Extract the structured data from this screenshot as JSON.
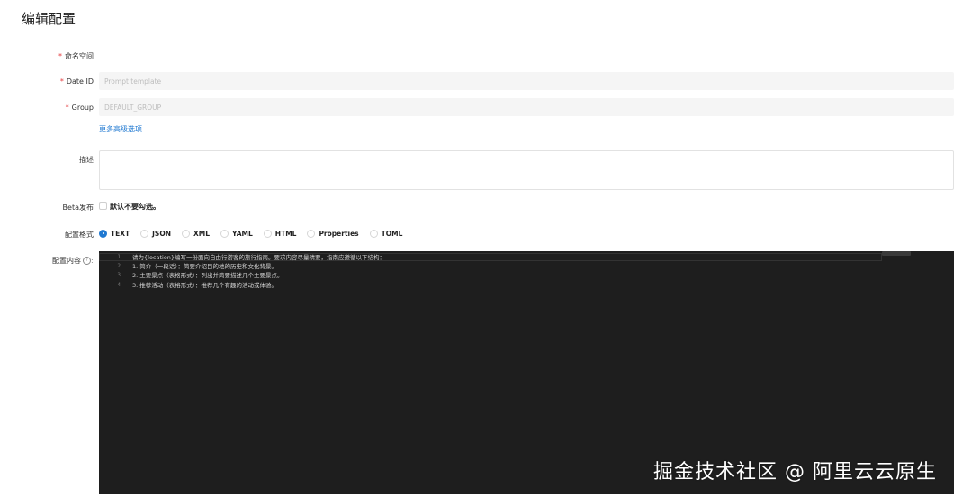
{
  "page": {
    "title": "编辑配置"
  },
  "form": {
    "namespace": {
      "label": "命名空间",
      "required_mark": "*"
    },
    "data_id": {
      "label": "Date ID",
      "required_mark": "*",
      "placeholder": "Prompt template"
    },
    "group": {
      "label": "Group",
      "required_mark": "*",
      "placeholder": "DEFAULT_GROUP"
    },
    "advanced_link": "更多高级选项",
    "description": {
      "label": "描述"
    },
    "beta": {
      "label": "Beta发布",
      "checkbox_text": "默认不要勾选。"
    },
    "format": {
      "label": "配置格式",
      "options": [
        "TEXT",
        "JSON",
        "XML",
        "YAML",
        "HTML",
        "Properties",
        "TOML"
      ],
      "selected": "TEXT"
    },
    "content": {
      "label": "配置内容",
      "help_symbol": "?",
      "colon": ":",
      "lines": [
        {
          "num": "1",
          "text": "请为{location}编写一份面向自由行游客的旅行指南。要求内容尽量精要，指南应遵循以下结构："
        },
        {
          "num": "2",
          "text": "1. 简介（一段话）：简要介绍目的地的历史和文化背景。"
        },
        {
          "num": "3",
          "text": "2. 主要景点（表格形式）：列出并简要描述几个主要景点。"
        },
        {
          "num": "4",
          "text": "3. 推荐活动（表格形式）：推荐几个有趣的活动或体验。"
        }
      ]
    }
  },
  "watermark": "掘金技术社区 @ 阿里云云原生"
}
